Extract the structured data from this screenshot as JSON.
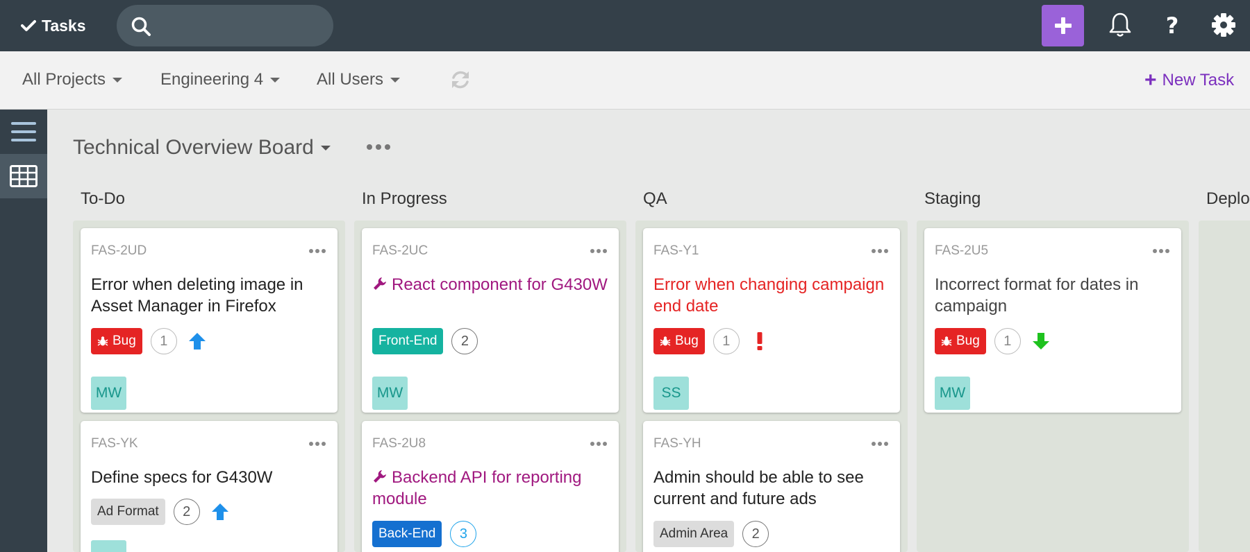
{
  "app": {
    "name": "Tasks"
  },
  "search": {
    "placeholder": ""
  },
  "filters": {
    "project": "All Projects",
    "team": "Engineering 4",
    "users": "All Users",
    "new_task": "New Task"
  },
  "board": {
    "title": "Technical Overview Board"
  },
  "columns": [
    {
      "name": "To-Do"
    },
    {
      "name": "In Progress"
    },
    {
      "name": "QA"
    },
    {
      "name": "Staging"
    },
    {
      "name": "Deplo"
    }
  ],
  "cards": [
    {
      "column": "To-Do",
      "id": "FAS-2UD",
      "title": "Error when deleting image in Asset Manager in Firefox",
      "title_style": "normal",
      "tag": "Bug",
      "tag_type": "bug",
      "count": "1",
      "priority": "high-arrow-up",
      "assignee": "MW"
    },
    {
      "column": "To-Do",
      "id": "FAS-YK",
      "title": "Define specs for G430W",
      "title_style": "normal",
      "tag": "Ad Format",
      "tag_type": "gray",
      "count": "2",
      "priority": "high-arrow-up"
    },
    {
      "column": "In Progress",
      "id": "FAS-2UC",
      "title": "React component for G430W",
      "title_style": "purple",
      "title_icon": "wrench-icon",
      "tag": "Front-End",
      "tag_type": "frontend",
      "count": "2",
      "assignee": "MW"
    },
    {
      "column": "In Progress",
      "id": "FAS-2U8",
      "title": "Backend API for reporting module",
      "title_style": "purple",
      "title_icon": "wrench-icon",
      "tag": "Back-End",
      "tag_type": "backend",
      "count": "3"
    },
    {
      "column": "QA",
      "id": "FAS-Y1",
      "title": "Error when changing campaign end date",
      "title_style": "red",
      "tag": "Bug",
      "tag_type": "bug",
      "count": "1",
      "priority": "urgent-exclamation",
      "assignee": "SS"
    },
    {
      "column": "QA",
      "id": "FAS-YH",
      "title": "Admin should be able to see current and future ads",
      "title_style": "normal",
      "tag": "Admin Area",
      "tag_type": "gray",
      "count": "2"
    },
    {
      "column": "Staging",
      "id": "FAS-2U5",
      "title": "Incorrect format for dates in campaign",
      "title_style": "normal",
      "tag": "Bug",
      "tag_type": "bug",
      "count": "1",
      "priority": "low-arrow-down",
      "assignee": "MW"
    }
  ],
  "colors": {
    "nav_bg": "#344049",
    "accent_purple": "#9a62d9",
    "new_task_purple": "#7b2fbe",
    "bug_red": "#e52424",
    "frontend_teal": "#15b3a0",
    "backend_blue": "#1570d0",
    "priority_up_blue": "#1e90ea",
    "priority_down_green": "#1ec21e",
    "avatar_bg": "#9ee0da"
  }
}
